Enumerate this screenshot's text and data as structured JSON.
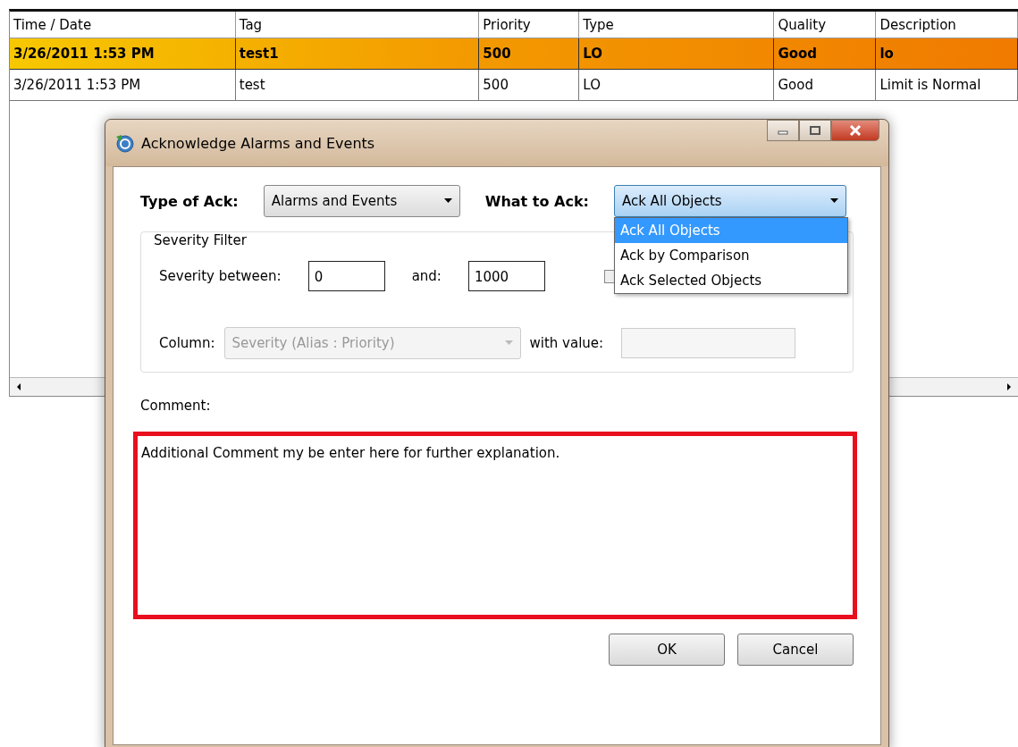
{
  "table": {
    "columns": [
      "Time / Date",
      "Tag",
      "Priority",
      "Type",
      "Quality",
      "Description"
    ],
    "rows": [
      {
        "highlighted": true,
        "cells": [
          "3/26/2011 1:53 PM",
          "test1",
          "500",
          "LO",
          "Good",
          "lo"
        ]
      },
      {
        "highlighted": false,
        "cells": [
          "3/26/2011 1:53 PM",
          "test",
          "500",
          "LO",
          "Good",
          "Limit is Normal"
        ]
      }
    ]
  },
  "dialog": {
    "title": "Acknowledge Alarms and Events",
    "type_of_ack": {
      "label": "Type of Ack:",
      "value": "Alarms and Events"
    },
    "what_to_ack": {
      "label": "What to Ack:",
      "value": "Ack All Objects",
      "expanded": true,
      "options": [
        {
          "label": "Ack All Objects",
          "selected": true
        },
        {
          "label": "Ack by Comparison",
          "selected": false
        },
        {
          "label": "Ack Selected Objects",
          "selected": false
        }
      ]
    },
    "severity_filter": {
      "title": "Severity Filter",
      "between_label": "Severity between:",
      "from": "0",
      "and_label": "and:",
      "to": "1000",
      "only_visible_checked": false,
      "column_label": "Column:",
      "column_value": "Severity (Alias : Priority)",
      "column_disabled": true,
      "with_value_label": "with value:"
    },
    "comment_label": "Comment:",
    "comment": "Additional Comment my be enter here for further explanation.",
    "buttons": [
      "OK",
      "Cancel"
    ]
  }
}
